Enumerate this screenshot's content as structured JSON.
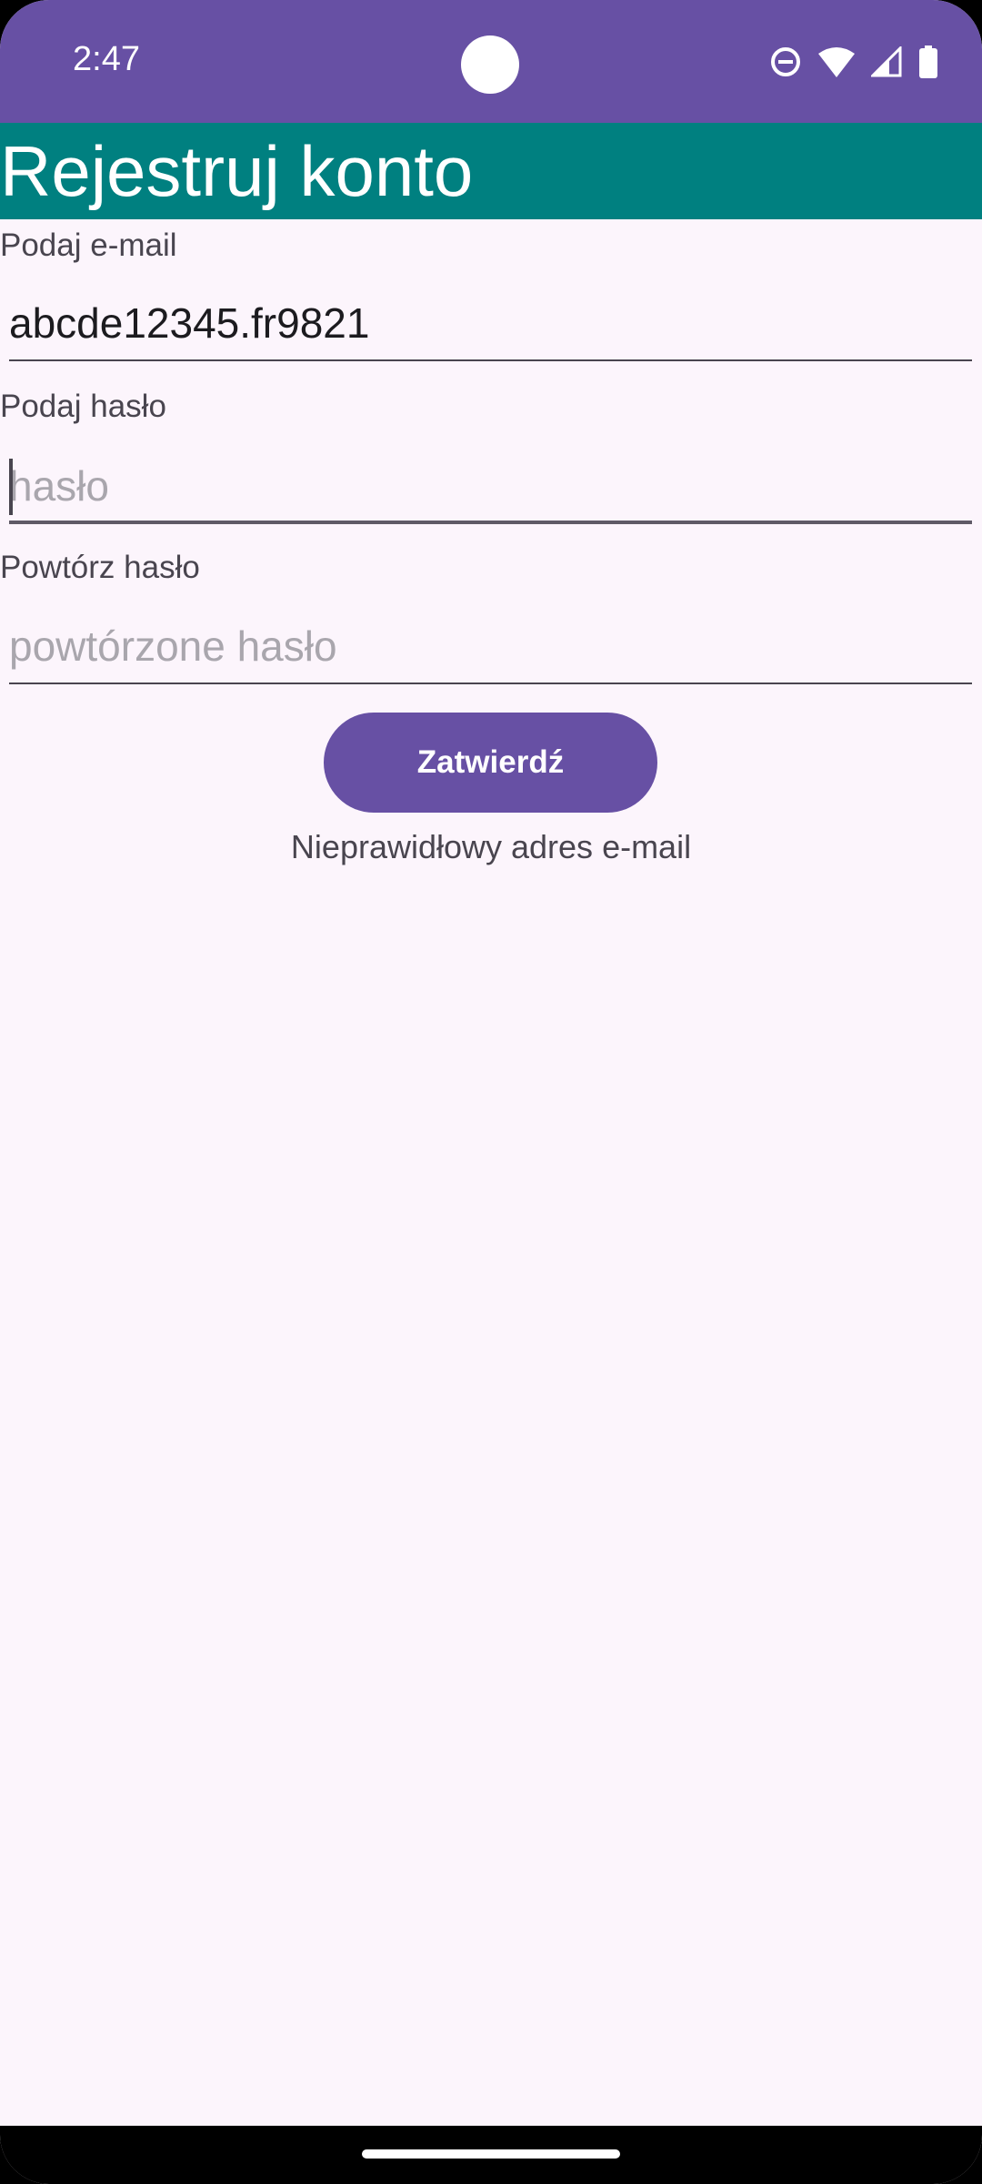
{
  "status_bar": {
    "time": "2:47",
    "icons": [
      "do-not-disturb-icon",
      "wifi-icon",
      "cellular-signal-icon",
      "battery-icon"
    ],
    "background": "#6750a4"
  },
  "app_bar": {
    "title": "Rejestruj konto",
    "background": "#008080"
  },
  "form": {
    "email": {
      "label": "Podaj e-mail",
      "value": "abcde12345.fr9821",
      "placeholder": ""
    },
    "password": {
      "label": "Podaj hasło",
      "value": "",
      "placeholder": "hasło",
      "focused": true
    },
    "repeat_password": {
      "label": "Powtórz hasło",
      "value": "",
      "placeholder": "powtórzone hasło"
    },
    "submit_label": "Zatwierdź",
    "error_message": "Nieprawidłowy adres e-mail"
  },
  "colors": {
    "accent": "#6750a4",
    "background": "#fcf5fc"
  }
}
